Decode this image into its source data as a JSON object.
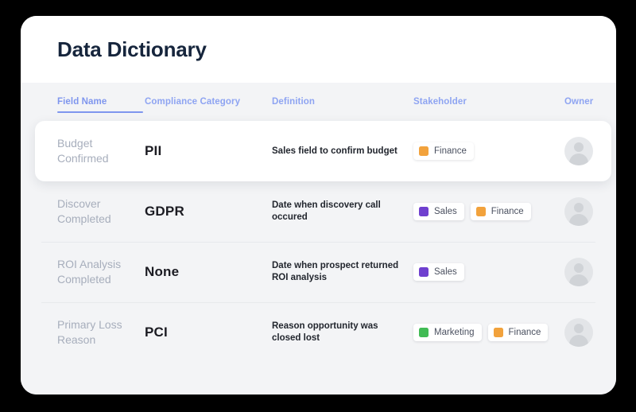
{
  "header": {
    "title": "Data Dictionary"
  },
  "table": {
    "columns": [
      {
        "label": "Field Name",
        "key": "field_name",
        "active": true
      },
      {
        "label": "Compliance Category",
        "key": "compliance_category",
        "active": false
      },
      {
        "label": "Definition",
        "key": "definition",
        "active": false
      },
      {
        "label": "Stakeholder",
        "key": "stakeholder",
        "active": false
      },
      {
        "label": "Owner",
        "key": "owner",
        "active": false
      }
    ],
    "rows": [
      {
        "field_name": "Budget Confirmed",
        "compliance_category": "PII",
        "definition": "Sales field to confirm budget",
        "stakeholders": [
          {
            "label": "Finance",
            "color": "#f2a23c"
          }
        ],
        "owner_icon": "avatar-placeholder-icon",
        "selected": true
      },
      {
        "field_name": "Discover Completed",
        "compliance_category": "GDPR",
        "definition": "Date when discovery call occured",
        "stakeholders": [
          {
            "label": "Sales",
            "color": "#6f40cf"
          },
          {
            "label": "Finance",
            "color": "#f2a23c"
          }
        ],
        "owner_icon": "avatar-placeholder-icon",
        "selected": false
      },
      {
        "field_name": "ROI Analysis Completed",
        "compliance_category": "None",
        "definition": "Date when prospect returned ROI analysis",
        "stakeholders": [
          {
            "label": "Sales",
            "color": "#6f40cf"
          }
        ],
        "owner_icon": "avatar-placeholder-icon",
        "selected": false
      },
      {
        "field_name": "Primary Loss Reason",
        "compliance_category": "PCI",
        "definition": "Reason opportunity was closed lost",
        "stakeholders": [
          {
            "label": "Marketing",
            "color": "#41bb55"
          },
          {
            "label": "Finance",
            "color": "#f2a23c"
          }
        ],
        "owner_icon": "avatar-placeholder-icon",
        "selected": false
      }
    ]
  },
  "theme": {
    "page_background": "#000000",
    "card_background": "#ffffff",
    "table_background": "#f3f4f6",
    "title_color": "#16253c",
    "column_header_color": "#8ea4f2",
    "active_underline_color": "#7f96ee",
    "field_name_color": "#a7aebc",
    "compliance_color": "#1b1b22",
    "definition_color": "#22262e",
    "tag_label_color": "#4b5160",
    "avatar_background": "#e3e5e8"
  }
}
